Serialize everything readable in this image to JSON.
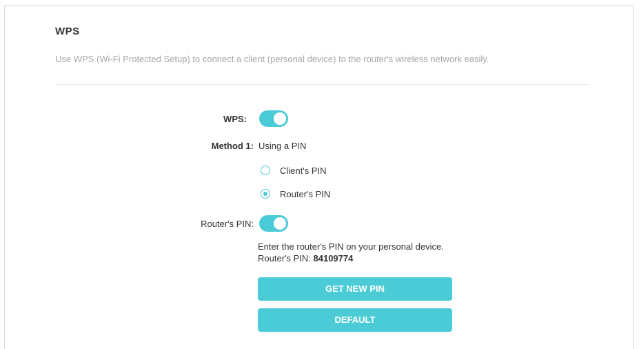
{
  "section": {
    "title": "WPS",
    "description": "Use WPS (Wi-Fi Protected Setup) to connect a client (personal device) to the router's wireless network easily."
  },
  "wps": {
    "label": "WPS:",
    "enabled": true
  },
  "method": {
    "label": "Method 1:",
    "value": "Using a PIN",
    "options": [
      {
        "label": "Client's PIN",
        "checked": false
      },
      {
        "label": "Router's PIN",
        "checked": true
      }
    ]
  },
  "router_pin": {
    "label": "Router's PIN:",
    "enabled": true,
    "instruction": "Enter the router's PIN on your personal device.",
    "pin_label": "Router's PIN: ",
    "pin_value": "84109774"
  },
  "buttons": {
    "get_new_pin": "GET NEW PIN",
    "default": "DEFAULT"
  },
  "colors": {
    "accent": "#4acbd6",
    "muted_text": "#a6a6a6"
  }
}
